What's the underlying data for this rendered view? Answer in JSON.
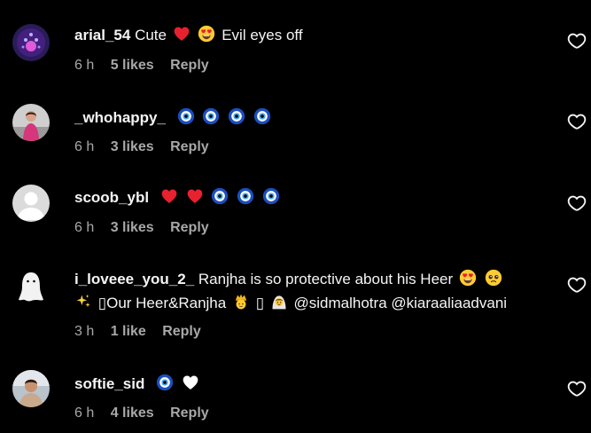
{
  "comments": [
    {
      "username": "arial_54",
      "text": "Cute",
      "text2": "Evil eyes off",
      "time": "6 h",
      "likes": "5 likes",
      "reply": "Reply"
    },
    {
      "username": "_whohappy_",
      "time": "6 h",
      "likes": "3 likes",
      "reply": "Reply"
    },
    {
      "username": "scoob_ybl",
      "time": "6 h",
      "likes": "3 likes",
      "reply": "Reply"
    },
    {
      "username": "i_loveee_you_2_",
      "text": "Ranjha is so protective about his Heer",
      "line2_text": "▯Our Heer&Ranjha",
      "line2_box": "▯",
      "mention1": "@sidmalhotra",
      "mention2": "@kiaraaliaadvani",
      "time": "3 h",
      "likes": "1 like",
      "reply": "Reply"
    },
    {
      "username": "softie_sid",
      "time": "6 h",
      "likes": "4 likes",
      "reply": "Reply"
    }
  ],
  "icons": {
    "like": "heart-outline-icon",
    "red_heart": "red-heart-emoji",
    "white_heart": "white-heart-emoji",
    "heart_eyes": "heart-eyes-emoji",
    "evil_eye": "nazar-amulet-emoji",
    "sparkles": "sparkles-emoji",
    "prince": "prince-emoji",
    "bride": "person-with-veil-emoji",
    "pleading": "pleading-face-emoji"
  },
  "colors": {
    "background": "#000000",
    "text": "#f5f5f5",
    "secondary": "#a8a8a8",
    "heart": "#e0245e"
  }
}
